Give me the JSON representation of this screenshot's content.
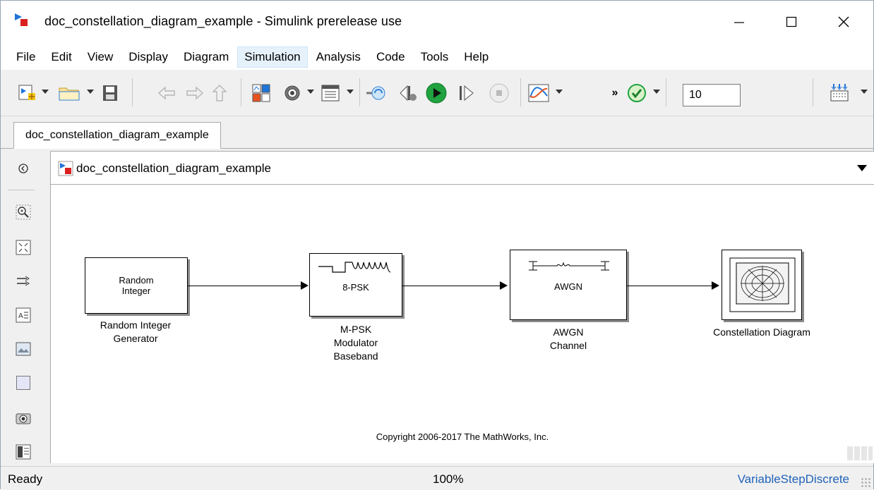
{
  "window": {
    "title": "doc_constellation_diagram_example - Simulink prerelease use",
    "icon": "simulink-model-icon"
  },
  "menu": {
    "items": [
      "File",
      "Edit",
      "View",
      "Display",
      "Diagram",
      "Simulation",
      "Analysis",
      "Code",
      "Tools",
      "Help"
    ],
    "active": "Simulation"
  },
  "toolbar": {
    "stop_time": "10",
    "icons": [
      "new-model-icon",
      "open-folder-icon",
      "save-icon",
      "back-arrow-icon",
      "forward-arrow-icon",
      "up-arrow-icon",
      "library-browser-icon",
      "model-settings-icon",
      "model-explorer-icon",
      "update-diagram-icon",
      "step-back-icon",
      "run-icon",
      "step-forward-icon",
      "stop-icon",
      "data-inspector-icon",
      "more-icon",
      "model-advisor-icon",
      "build-icon"
    ]
  },
  "tab": {
    "label": "doc_constellation_diagram_example"
  },
  "address": {
    "path": "doc_constellation_diagram_example"
  },
  "palette": [
    "navigate-back-icon",
    "zoom-icon",
    "fit-view-icon",
    "signal-routing-icon",
    "annotation-icon",
    "image-icon",
    "area-icon",
    "camera-icon",
    "model-browser-icon"
  ],
  "blocks": [
    {
      "name": "Random Integer Generator",
      "text": [
        "Random",
        "Integer"
      ],
      "label": [
        "Random Integer",
        "Generator"
      ]
    },
    {
      "name": "M-PSK Modulator Baseband",
      "text": [
        "8-PSK"
      ],
      "label": [
        "M-PSK",
        "Modulator",
        "Baseband"
      ]
    },
    {
      "name": "AWGN Channel",
      "text": [
        "AWGN"
      ],
      "label": [
        "AWGN",
        "Channel"
      ]
    },
    {
      "name": "Constellation Diagram",
      "text": [],
      "label": [
        "Constellation Diagram"
      ]
    }
  ],
  "copyright": "Copyright 2006-2017 The MathWorks, Inc.",
  "status": {
    "state": "Ready",
    "zoom": "100%",
    "solver": "VariableStepDiscrete"
  },
  "colors": {
    "accent": "#1f62b8",
    "menu_active_bg": "#e5f1fb",
    "run_green": "#1fa23f"
  }
}
